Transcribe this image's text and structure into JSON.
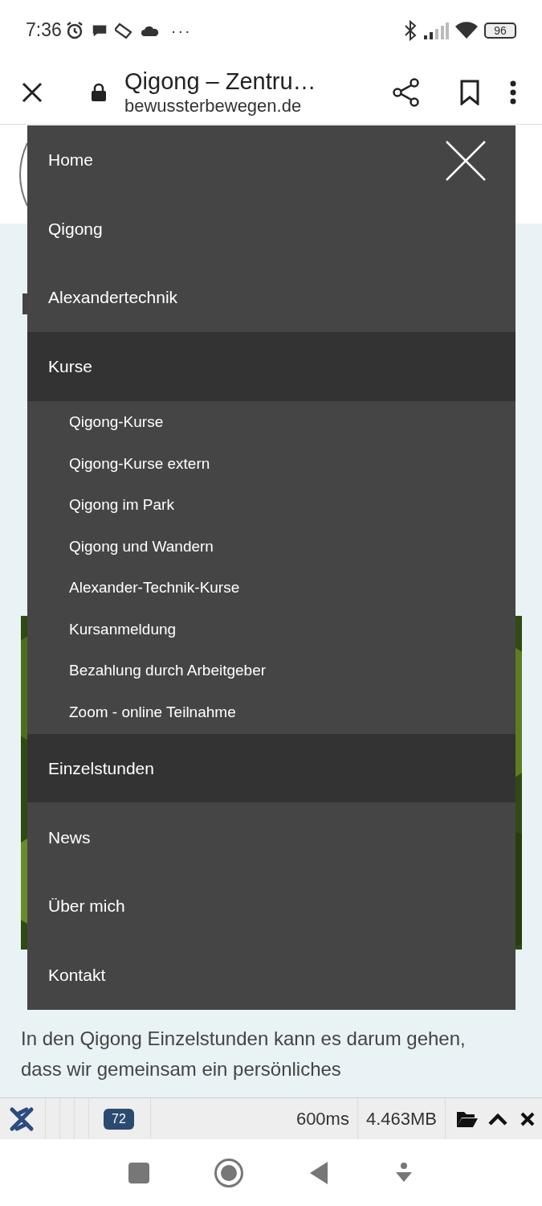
{
  "status_bar": {
    "time": "7:36",
    "more": "···",
    "battery": "96"
  },
  "browser": {
    "title": "Qigong – Zentru…",
    "url": "bewussterbewegen.de"
  },
  "menu": {
    "items": [
      {
        "label": "Home",
        "active": false
      },
      {
        "label": "Qigong",
        "active": false
      },
      {
        "label": "Alexandertechnik",
        "active": false
      },
      {
        "label": "Kurse",
        "active": true,
        "expanded": true,
        "children": [
          {
            "label": "Qigong-Kurse"
          },
          {
            "label": "Qigong-Kurse extern"
          },
          {
            "label": "Qigong im Park"
          },
          {
            "label": "Qigong und Wandern"
          },
          {
            "label": "Alexander-Technik-Kurse"
          },
          {
            "label": "Kursanmeldung"
          },
          {
            "label": "Bezahlung durch Arbeitgeber"
          },
          {
            "label": "Zoom - online Teilnahme"
          }
        ]
      },
      {
        "label": "Einzelstunden",
        "active": true
      },
      {
        "label": "News",
        "active": false
      },
      {
        "label": "Über mich",
        "active": false
      },
      {
        "label": "Kontakt",
        "active": false
      }
    ]
  },
  "page": {
    "paragraph": "In den Qigong Einzelstunden kann es darum gehen, dass wir gemeinsam ein persönliches"
  },
  "debug_bar": {
    "count": "72",
    "time": "600ms",
    "memory": "4.463MB"
  }
}
